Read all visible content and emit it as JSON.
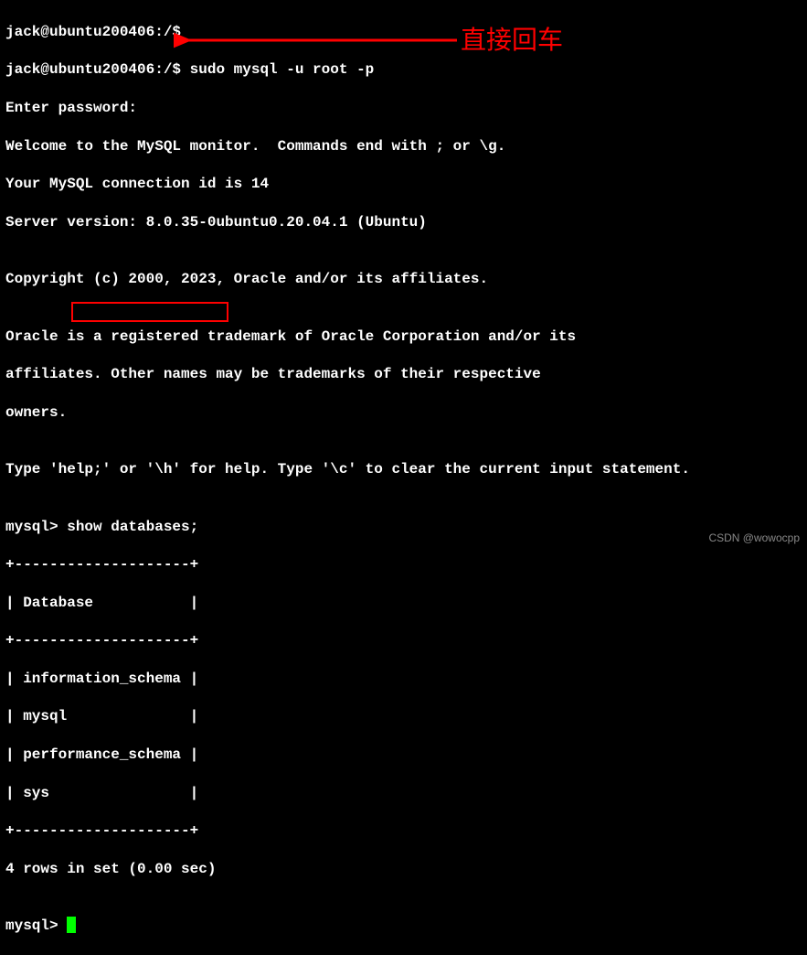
{
  "terminal": {
    "lines": [
      "jack@ubuntu200406:/$",
      "jack@ubuntu200406:/$ sudo mysql -u root -p",
      "Enter password:",
      "Welcome to the MySQL monitor.  Commands end with ; or \\g.",
      "Your MySQL connection id is 14",
      "Server version: 8.0.35-0ubuntu0.20.04.1 (Ubuntu)",
      "",
      "Copyright (c) 2000, 2023, Oracle and/or its affiliates.",
      "",
      "Oracle is a registered trademark of Oracle Corporation and/or its",
      "affiliates. Other names may be trademarks of their respective",
      "owners.",
      "",
      "Type 'help;' or '\\h' for help. Type '\\c' to clear the current input statement.",
      "",
      "mysql> show databases;",
      "+--------------------+",
      "| Database           |",
      "+--------------------+",
      "| information_schema |",
      "| mysql              |",
      "| performance_schema |",
      "| sys                |",
      "+--------------------+",
      "4 rows in set (0.00 sec)",
      "",
      "mysql> "
    ]
  },
  "annotation": {
    "text": "直接回车"
  },
  "watermark": {
    "text": "CSDN @wowocpp"
  }
}
